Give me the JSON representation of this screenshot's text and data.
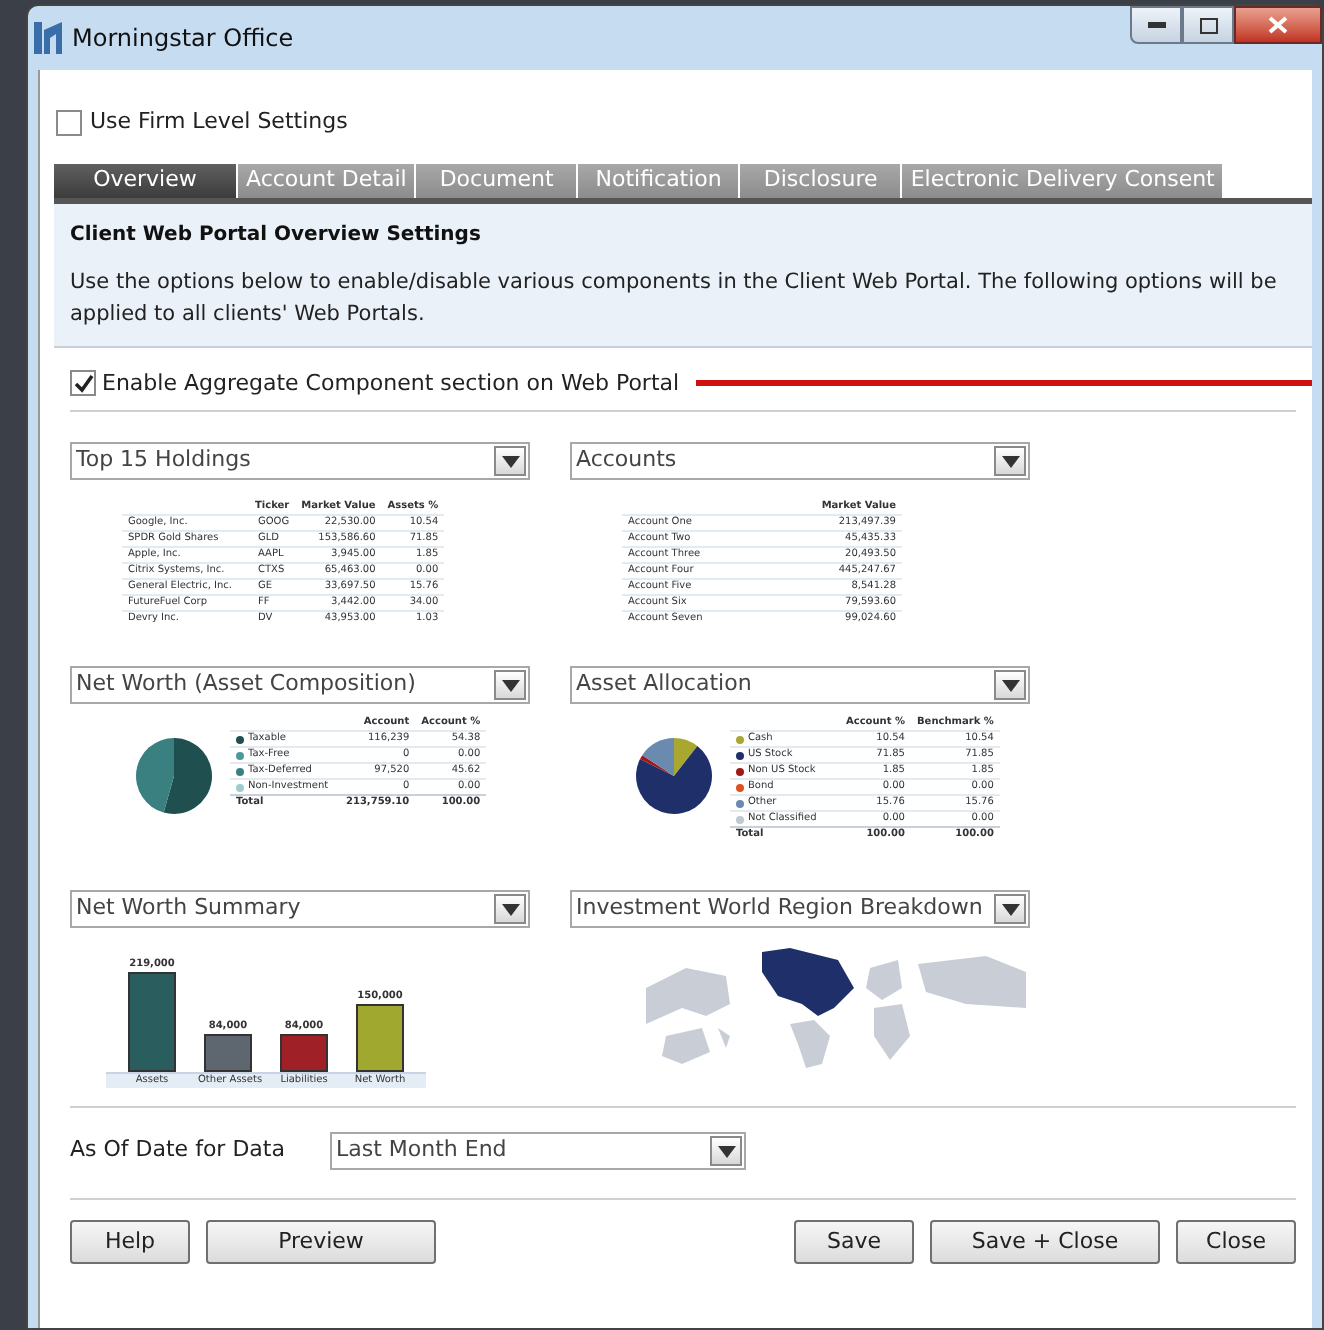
{
  "window": {
    "title": "Morningstar Office"
  },
  "use_firm_level": {
    "label": "Use Firm Level Settings",
    "checked": false
  },
  "tabs": [
    {
      "label": "Overview",
      "selected": true
    },
    {
      "label": "Account Detail",
      "selected": false
    },
    {
      "label": "Document",
      "selected": false
    },
    {
      "label": "Notification",
      "selected": false
    },
    {
      "label": "Disclosure",
      "selected": false
    },
    {
      "label": "Electronic Delivery Consent",
      "selected": false
    }
  ],
  "header": {
    "title": "Client Web Portal Overview Settings",
    "description": "Use the options below to enable/disable various components in the Client Web Portal. The following options will be applied to all clients' Web Portals."
  },
  "enable_aggregate": {
    "label": "Enable Aggregate Component section on Web Portal",
    "checked": true
  },
  "panels": [
    {
      "kind": "holdings",
      "dropdown": "Top 15 Holdings",
      "columns": [
        "",
        "Ticker",
        "Market Value",
        "Assets %"
      ],
      "rows": [
        [
          "Google, Inc.",
          "GOOG",
          "22,530.00",
          "10.54"
        ],
        [
          "SPDR Gold Shares",
          "GLD",
          "153,586.60",
          "71.85"
        ],
        [
          "Apple, Inc.",
          "AAPL",
          "3,945.00",
          "1.85"
        ],
        [
          "Citrix Systems, Inc.",
          "CTXS",
          "65,463.00",
          "0.00"
        ],
        [
          "General Electric, Inc.",
          "GE",
          "33,697.50",
          "15.76"
        ],
        [
          "FutureFuel Corp",
          "FF",
          "3,442.00",
          "34.00"
        ],
        [
          "Devry Inc.",
          "DV",
          "43,953.00",
          "1.03"
        ]
      ]
    },
    {
      "kind": "accounts",
      "dropdown": "Accounts",
      "columns": [
        "",
        "Market Value"
      ],
      "rows": [
        [
          "Account One",
          "213,497.39"
        ],
        [
          "Account Two",
          "45,435.33"
        ],
        [
          "Account Three",
          "20,493.50"
        ],
        [
          "Account Four",
          "445,247.67"
        ],
        [
          "Account Five",
          "8,541.28"
        ],
        [
          "Account Six",
          "79,593.60"
        ],
        [
          "Account Seven",
          "99,024.60"
        ]
      ]
    },
    {
      "kind": "pie",
      "dropdown": "Net Worth (Asset Composition)",
      "columns": [
        "",
        "Account",
        "Account %"
      ],
      "rows": [
        {
          "cells": [
            "Taxable",
            "116,239",
            "54.38"
          ],
          "color": "#1f4f4f"
        },
        {
          "cells": [
            "Tax-Free",
            "0",
            "0.00"
          ],
          "color": "#4a9a9a"
        },
        {
          "cells": [
            "Tax-Deferred",
            "97,520",
            "45.62"
          ],
          "color": "#3a8080"
        },
        {
          "cells": [
            "Non-Investment",
            "0",
            "0.00"
          ],
          "color": "#9ccccc"
        }
      ],
      "total": [
        "Total",
        "213,759.10",
        "100.00"
      ]
    },
    {
      "kind": "pie",
      "dropdown": "Asset Allocation",
      "columns": [
        "",
        "Account %",
        "Benchmark %"
      ],
      "rows": [
        {
          "cells": [
            "Cash",
            "10.54",
            "10.54"
          ],
          "color": "#a8a830"
        },
        {
          "cells": [
            "US Stock",
            "71.85",
            "71.85"
          ],
          "color": "#1f2f6a"
        },
        {
          "cells": [
            "Non US Stock",
            "1.85",
            "1.85"
          ],
          "color": "#a01818"
        },
        {
          "cells": [
            "Bond",
            "0.00",
            "0.00"
          ],
          "color": "#e05020"
        },
        {
          "cells": [
            "Other",
            "15.76",
            "15.76"
          ],
          "color": "#6a8ab0"
        },
        {
          "cells": [
            "Not Classified",
            "0.00",
            "0.00"
          ],
          "color": "#c0c8d0"
        }
      ],
      "total": [
        "Total",
        "100.00",
        "100.00"
      ]
    },
    {
      "kind": "bars",
      "dropdown": "Net Worth Summary",
      "bars": [
        {
          "label": "Assets",
          "value": "219,000",
          "color": "#2a5e5e"
        },
        {
          "label": "Other Assets",
          "value": "84,000",
          "color": "#5e6670"
        },
        {
          "label": "Liabilities",
          "value": "84,000",
          "color": "#a02028"
        },
        {
          "label": "Net Worth",
          "value": "150,000",
          "color": "#a0a830"
        }
      ]
    },
    {
      "kind": "map",
      "dropdown": "Investment World Region Breakdown"
    }
  ],
  "as_of_date": {
    "label": "As Of Date for Data",
    "value": "Last Month End"
  },
  "buttons_left": [
    "Help",
    "Preview"
  ],
  "buttons_right": [
    "Save",
    "Save + Close",
    "Close"
  ]
}
